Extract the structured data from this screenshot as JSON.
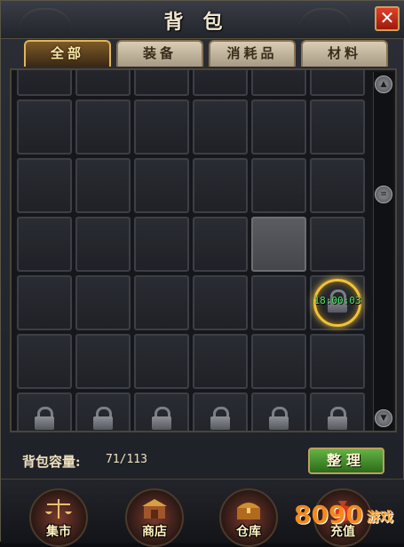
{
  "window": {
    "title": "背包",
    "close_label": "✕"
  },
  "tabs": [
    {
      "label": "全部",
      "active": true
    },
    {
      "label": "装备",
      "active": false
    },
    {
      "label": "消耗品",
      "active": false
    },
    {
      "label": "材料",
      "active": false
    }
  ],
  "inventory": {
    "columns": 6,
    "unlocked_rows": 6,
    "locked_row_count": 1,
    "selected_slot": {
      "row": 4,
      "col": 5
    },
    "timer_slot": {
      "row": 5,
      "col": 6,
      "text": "18:00:03"
    }
  },
  "scrollbar": {
    "up_icon": "up-arrow-icon",
    "thumb_icon": "grip-icon",
    "down_icon": "down-arrow-icon"
  },
  "capacity": {
    "label": "背包容量:",
    "value": "71/113"
  },
  "sort_button": {
    "label": "整理"
  },
  "bottom_menu": [
    {
      "label": "集市",
      "icon": "scales-icon"
    },
    {
      "label": "商店",
      "icon": "shop-icon"
    },
    {
      "label": "仓库",
      "icon": "treasure-chest-icon"
    },
    {
      "label": "充值",
      "icon": "money-bag-icon"
    }
  ],
  "watermark": {
    "text_num": "8090",
    "text_cn": "游戏"
  },
  "colors": {
    "accent_gold": "#e0b55a",
    "timer_green": "#4af26a",
    "close_red": "#c8321c"
  }
}
